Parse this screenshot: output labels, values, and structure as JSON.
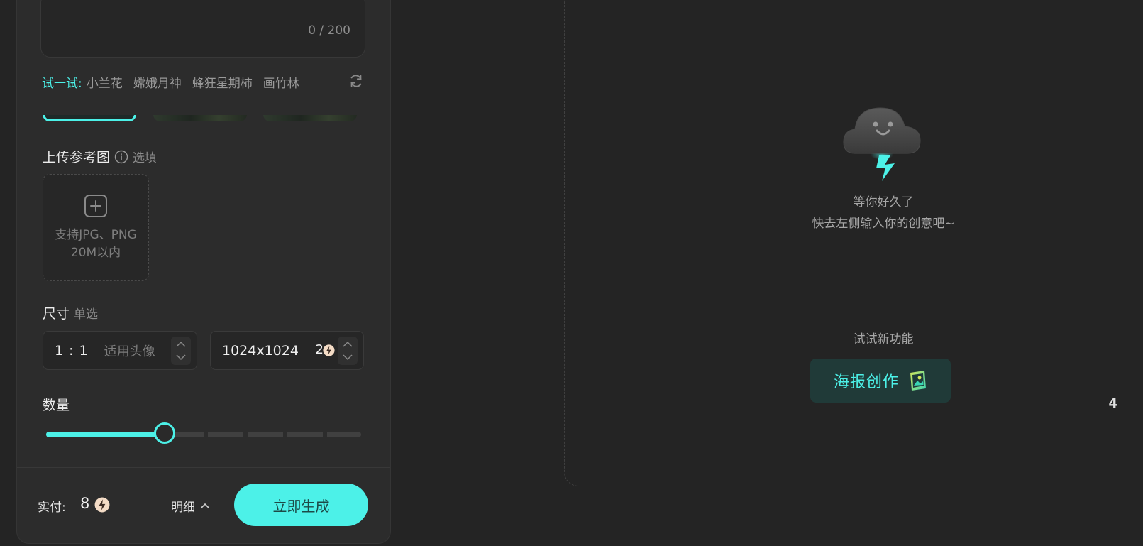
{
  "prompt": {
    "char_count": "0 / 200"
  },
  "try_row": {
    "label": "试一试:",
    "items": [
      "小兰花",
      "嫦娥月神",
      "蜂狂星期柿",
      "画竹林"
    ]
  },
  "upload": {
    "title": "上传参考图",
    "optional": "选填",
    "hint_line1": "支持JPG、PNG",
    "hint_line2": "20M以内"
  },
  "size": {
    "title": "尺寸",
    "mode": "单选",
    "ratio": "1 : 1",
    "ratio_desc": "适用头像",
    "resolution": "1024x1024",
    "cost": "2"
  },
  "quantity": {
    "title": "数量",
    "value": "4",
    "slider_fraction": 0.375
  },
  "footer": {
    "pay_label": "实付:",
    "pay_value": "8",
    "detail_label": "明细",
    "generate_label": "立即生成"
  },
  "empty_state": {
    "line1": "等你好久了",
    "line2": "快去左侧输入你的创意吧~"
  },
  "new_feature": {
    "label": "试试新功能",
    "poster_label": "海报创作"
  },
  "colors": {
    "accent": "#4cf1e8",
    "background": "#242424",
    "panel": "#2c2c2c"
  },
  "icons": [
    "refresh-icon",
    "info-icon",
    "upload-plus-icon",
    "chevron-up-icon",
    "chevron-down-icon",
    "coin-icon",
    "cloud-mascot-icon",
    "poster-icon"
  ]
}
